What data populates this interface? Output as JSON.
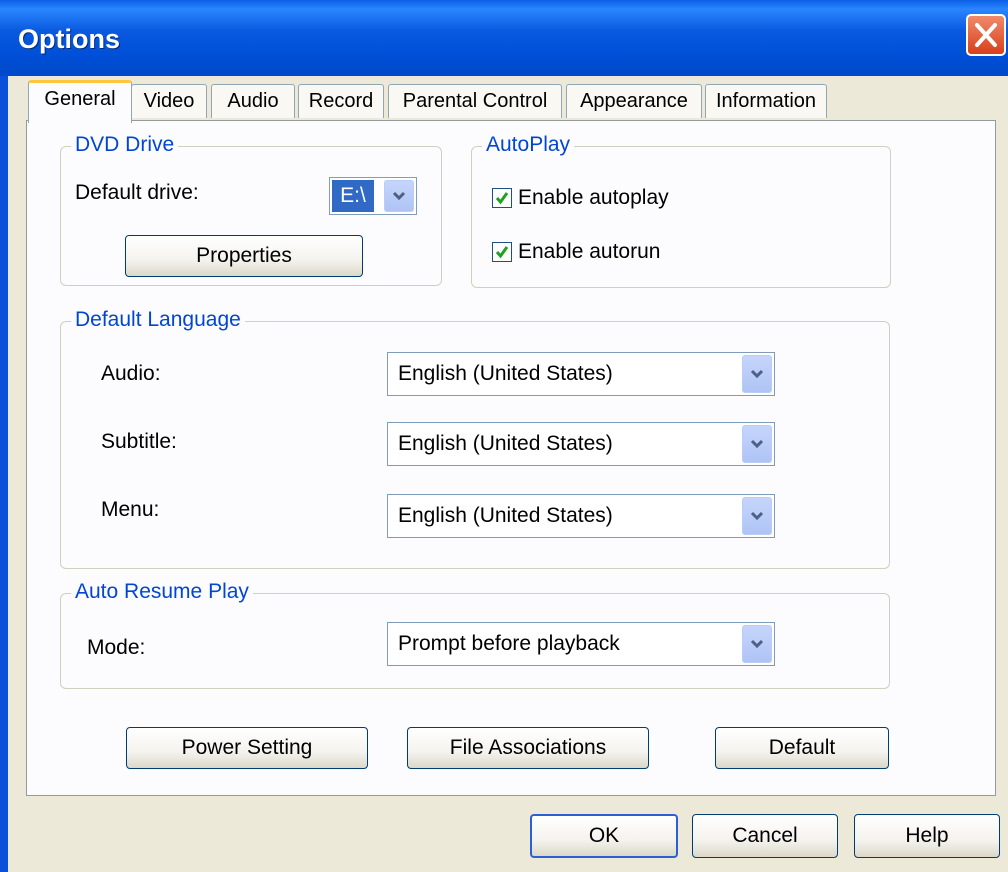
{
  "window": {
    "title": "Options"
  },
  "tabs": [
    "General",
    "Video",
    "Audio",
    "Record",
    "Parental Control",
    "Appearance",
    "Information"
  ],
  "dvd_drive": {
    "legend": "DVD Drive",
    "default_drive_label": "Default drive:",
    "default_drive_value": "E:\\",
    "properties_button": "Properties"
  },
  "autoplay": {
    "legend": "AutoPlay",
    "enable_autoplay": "Enable autoplay",
    "enable_autoplay_checked": true,
    "enable_autorun": "Enable autorun",
    "enable_autorun_checked": true
  },
  "default_language": {
    "legend": "Default Language",
    "audio_label": "Audio:",
    "audio_value": "English (United States)",
    "subtitle_label": "Subtitle:",
    "subtitle_value": "English (United States)",
    "menu_label": "Menu:",
    "menu_value": "English (United States)"
  },
  "auto_resume": {
    "legend": "Auto Resume Play",
    "mode_label": "Mode:",
    "mode_value": "Prompt before playback"
  },
  "panel_buttons": {
    "power_setting": "Power Setting",
    "file_associations": "File Associations",
    "default": "Default"
  },
  "dialog_buttons": {
    "ok": "OK",
    "cancel": "Cancel",
    "help": "Help"
  },
  "colors": {
    "title_bar": "#0a5ae0",
    "group_legend": "#0046d5",
    "close_button": "#d8401a"
  },
  "icons": {
    "close": "close-icon",
    "dropdown": "chevron-down-icon",
    "check": "check-icon"
  }
}
